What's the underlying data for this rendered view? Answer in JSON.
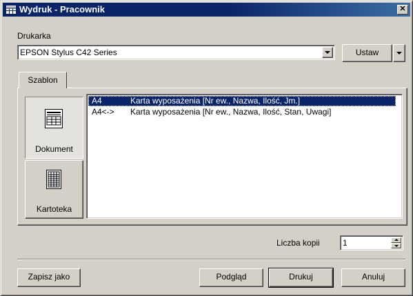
{
  "window": {
    "title": "Wydruk - Pracownik",
    "close_glyph": "✕",
    "title_icon": "table-icon"
  },
  "printer": {
    "label": "Drukarka",
    "selected": "EPSON Stylus C42 Series",
    "setup_button": "Ustaw"
  },
  "tabs": [
    {
      "label": "Szablon",
      "active": true
    }
  ],
  "side_buttons": [
    {
      "label": "Dokument",
      "icon": "document-icon",
      "pressed": true
    },
    {
      "label": "Kartoteka",
      "icon": "card-index-icon",
      "pressed": false
    }
  ],
  "templates": [
    {
      "code": "A4",
      "description": "Karta wyposażenia [Nr ew., Nazwa, Ilość, Jm.]",
      "selected": true
    },
    {
      "code": "A4<->",
      "description": "Karta wyposażenia [Nr ew., Nazwa, Ilość, Stan, Uwagi]",
      "selected": false
    }
  ],
  "copies": {
    "label": "Liczba kopii",
    "value": "1"
  },
  "buttons": {
    "save_as": "Zapisz jako",
    "preview": "Podgląd",
    "print": "Drukuj",
    "cancel": "Anuluj"
  },
  "colors": {
    "title_bar": "#0a246a",
    "selection": "#0a246a",
    "face": "#d4d0c8"
  }
}
